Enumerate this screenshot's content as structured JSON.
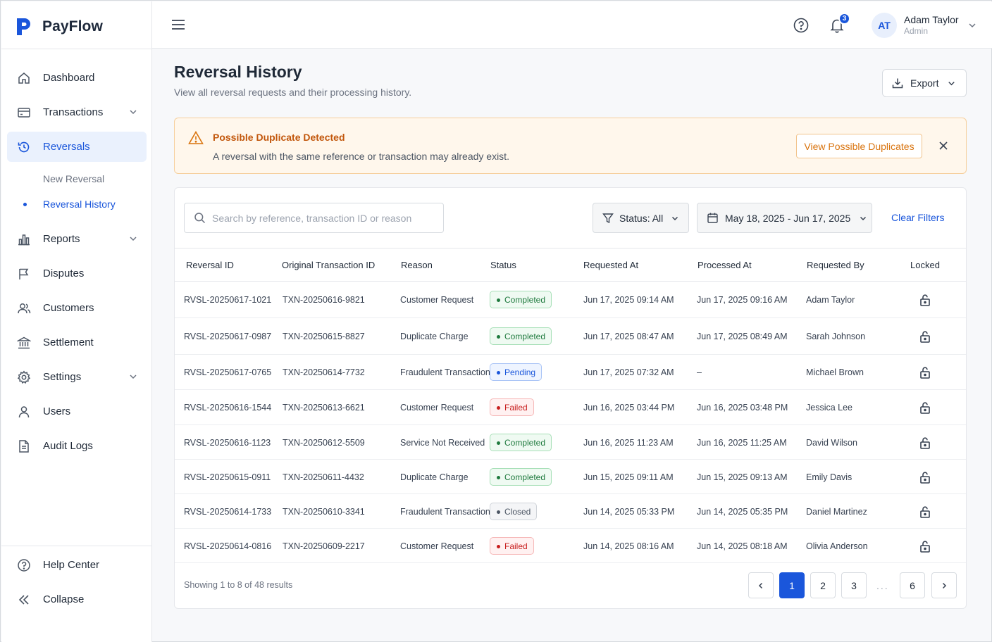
{
  "app": {
    "name": "PayFlow"
  },
  "sidebar": {
    "items": [
      {
        "label": "Dashboard",
        "icon": "home-icon"
      },
      {
        "label": "Transactions",
        "icon": "card-icon",
        "expandable": true
      },
      {
        "label": "Reversals",
        "icon": "history-icon",
        "active": true
      },
      {
        "label": "Reports",
        "icon": "bar-chart-icon",
        "expandable": true
      },
      {
        "label": "Disputes",
        "icon": "flag-icon"
      },
      {
        "label": "Customers",
        "icon": "users-icon"
      },
      {
        "label": "Settlement",
        "icon": "bank-icon"
      },
      {
        "label": "Settings",
        "icon": "gear-icon",
        "expandable": true
      },
      {
        "label": "Users",
        "icon": "user-icon"
      },
      {
        "label": "Audit Logs",
        "icon": "document-icon"
      }
    ],
    "subitems": [
      {
        "label": "New Reversal"
      },
      {
        "label": "Reversal History",
        "active": true
      }
    ],
    "bottom": [
      {
        "label": "Help Center",
        "icon": "help-icon"
      },
      {
        "label": "Collapse",
        "icon": "collapse-icon"
      }
    ]
  },
  "topbar": {
    "notifications_count": "3",
    "user": {
      "initials": "AT",
      "name": "Adam Taylor",
      "role": "Admin"
    }
  },
  "page": {
    "title": "Reversal History",
    "subtitle": "View all reversal requests and their processing history.",
    "export_label": "Export"
  },
  "alert": {
    "title": "Possible Duplicate Detected",
    "text": "A reversal with the same reference or transaction may already exist.",
    "button": "View Possible Duplicates"
  },
  "filters": {
    "search_placeholder": "Search by reference, transaction ID or reason",
    "status": "Status: All",
    "date_range": "May 18, 2025 - Jun 17, 2025",
    "clear": "Clear Filters"
  },
  "table": {
    "columns": [
      "Reversal ID",
      "Original Transaction ID",
      "Reason",
      "Status",
      "Requested At",
      "Processed At",
      "Requested By",
      "Locked"
    ],
    "rows": [
      {
        "id": "RVSL-20250617-1021",
        "txn": "TXN-20250616-9821",
        "reason": "Customer Request",
        "status": "Completed",
        "requested": "Jun 17, 2025 09:14 AM",
        "processed": "Jun 17, 2025 09:16 AM",
        "by": "Adam Taylor"
      },
      {
        "id": "RVSL-20250617-0987",
        "txn": "TXN-20250615-8827",
        "reason": "Duplicate Charge",
        "status": "Completed",
        "requested": "Jun 17, 2025 08:47 AM",
        "processed": "Jun 17, 2025 08:49 AM",
        "by": "Sarah Johnson"
      },
      {
        "id": "RVSL-20250617-0765",
        "txn": "TXN-20250614-7732",
        "reason": "Fraudulent Transaction",
        "status": "Pending",
        "requested": "Jun 17, 2025 07:32 AM",
        "processed": "–",
        "by": "Michael Brown"
      },
      {
        "id": "RVSL-20250616-1544",
        "txn": "TXN-20250613-6621",
        "reason": "Customer Request",
        "status": "Failed",
        "requested": "Jun 16, 2025 03:44 PM",
        "processed": "Jun 16, 2025 03:48 PM",
        "by": "Jessica Lee"
      },
      {
        "id": "RVSL-20250616-1123",
        "txn": "TXN-20250612-5509",
        "reason": "Service Not Received",
        "status": "Completed",
        "requested": "Jun 16, 2025 11:23 AM",
        "processed": "Jun 16, 2025 11:25 AM",
        "by": "David Wilson"
      },
      {
        "id": "RVSL-20250615-0911",
        "txn": "TXN-20250611-4432",
        "reason": "Duplicate Charge",
        "status": "Completed",
        "requested": "Jun 15, 2025 09:11 AM",
        "processed": "Jun 15, 2025 09:13 AM",
        "by": "Emily Davis"
      },
      {
        "id": "RVSL-20250614-1733",
        "txn": "TXN-20250610-3341",
        "reason": "Fraudulent Transaction",
        "status": "Closed",
        "requested": "Jun 14, 2025 05:33 PM",
        "processed": "Jun 14, 2025 05:35 PM",
        "by": "Daniel Martinez"
      },
      {
        "id": "RVSL-20250614-0816",
        "txn": "TXN-20250609-2217",
        "reason": "Customer Request",
        "status": "Failed",
        "requested": "Jun 14, 2025 08:16 AM",
        "processed": "Jun 14, 2025 08:18 AM",
        "by": "Olivia Anderson"
      }
    ]
  },
  "pagination": {
    "summary": "Showing 1 to 8 of 48 results",
    "pages": [
      "1",
      "2",
      "3",
      "6"
    ],
    "current": "1",
    "ellipsis": "..."
  },
  "colors": {
    "accent": "#1a56db",
    "warning": "#d9730d"
  }
}
